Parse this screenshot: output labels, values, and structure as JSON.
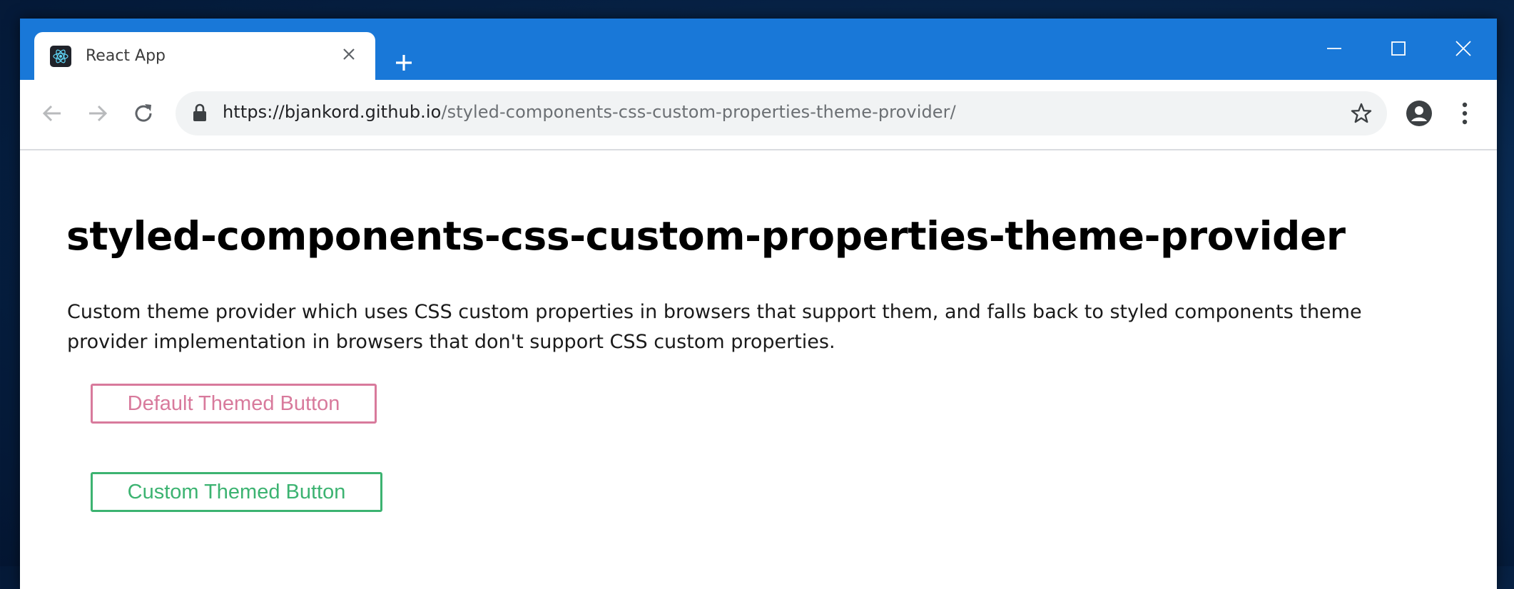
{
  "browser": {
    "tab": {
      "title": "React App",
      "favicon": "react-logo-icon"
    },
    "url": {
      "host": "https://bjankord.github.io",
      "path": "/styled-components-css-custom-properties-theme-provider/"
    },
    "colors": {
      "titlebar": "#1978d8",
      "omnibox": "#f1f3f4"
    }
  },
  "page": {
    "title": "styled-components-css-custom-properties-theme-provider",
    "description": "Custom theme provider which uses CSS custom properties in browsers that support them, and falls back to styled components theme provider implementation in browsers that don't support CSS custom properties.",
    "buttons": {
      "default_label": "Default Themed Button",
      "custom_label": "Custom Themed Button"
    },
    "colors": {
      "default_theme": "#d87a9c",
      "custom_theme": "#3cb371"
    }
  }
}
